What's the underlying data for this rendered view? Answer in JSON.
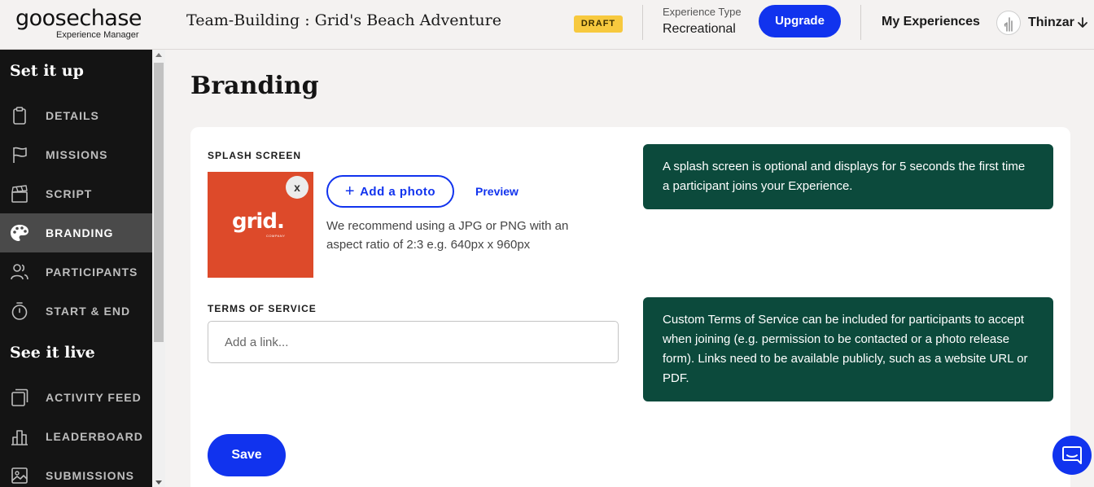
{
  "header": {
    "logo_text": "goosechase",
    "logo_sub": "Experience Manager",
    "experience_title": "Team-Building : Grid's Beach Adventure",
    "status_badge": "DRAFT",
    "experience_type_label": "Experience Type",
    "experience_type_value": "Recreational",
    "upgrade_label": "Upgrade",
    "my_experiences_label": "My Experiences",
    "user_name": "Thinzar",
    "user_menu_icon": "chevron-down-icon"
  },
  "sidebar": {
    "section_setup": "Set it up",
    "section_live": "See it live",
    "items": [
      {
        "label": "DETAILS",
        "icon": "clipboard-icon"
      },
      {
        "label": "MISSIONS",
        "icon": "flag-icon"
      },
      {
        "label": "SCRIPT",
        "icon": "clapperboard-icon"
      },
      {
        "label": "BRANDING",
        "icon": "palette-icon"
      },
      {
        "label": "PARTICIPANTS",
        "icon": "users-icon"
      },
      {
        "label": "START & END",
        "icon": "stopwatch-icon"
      },
      {
        "label": "ACTIVITY FEED",
        "icon": "feed-icon"
      },
      {
        "label": "LEADERBOARD",
        "icon": "bar-chart-icon"
      },
      {
        "label": "SUBMISSIONS",
        "icon": "image-icon"
      }
    ],
    "active_item": "BRANDING"
  },
  "main": {
    "page_title": "Branding",
    "splash": {
      "section_label": "SPLASH SCREEN",
      "image_logo_text": "grid.",
      "image_logo_subtext": "COMPANY",
      "remove_label": "x",
      "add_photo_label": "Add a photo",
      "preview_label": "Preview",
      "recommendation": "We recommend using a JPG or PNG with an aspect ratio of 2:3 e.g. 640px x 960px",
      "info": "A splash screen is optional and displays for 5 seconds the first time a participant joins your Experience."
    },
    "tos": {
      "section_label": "TERMS OF SERVICE",
      "input_value": "",
      "input_placeholder": "Add a link...",
      "info": "Custom Terms of Service can be included for participants to accept when joining (e.g. permission to be contacted or a photo release form). Links need to be available publicly, such as a website URL or PDF."
    },
    "save_label": "Save"
  },
  "colors": {
    "accent": "#1133ee",
    "info_box": "#0c4a3c",
    "badge": "#f7c93e",
    "splash_bg": "#dd4a2a",
    "sidebar_bg": "#141414"
  },
  "chat_icon": "chat-bubble-icon"
}
